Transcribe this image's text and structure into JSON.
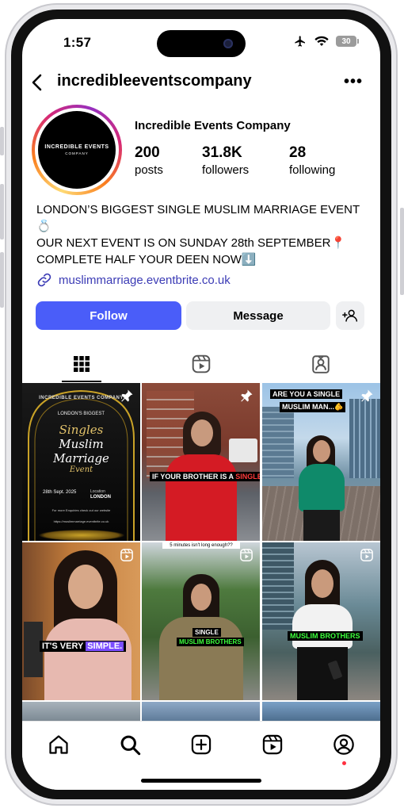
{
  "status_bar": {
    "time": "1:57",
    "battery": "30"
  },
  "header": {
    "username": "incredibleeventscompany",
    "more": "•••"
  },
  "profile": {
    "avatar_line1": "INCREDIBLE EVENTS",
    "avatar_line2": "COMPANY",
    "full_name": "Incredible Events Company",
    "stats": [
      {
        "value": "200",
        "label": "posts"
      },
      {
        "value": "31.8K",
        "label": "followers"
      },
      {
        "value": "28",
        "label": "following"
      }
    ],
    "bio": [
      "LONDON’S BIGGEST SINGLE MUSLIM MARRIAGE EVENT💍",
      "OUR NEXT EVENT IS ON SUNDAY 28th SEPTEMBER📍",
      "COMPLETE HALF YOUR DEEN NOW⬇️"
    ],
    "link": "muslimmarriage.eventbrite.co.uk"
  },
  "actions": {
    "follow": "Follow",
    "message": "Message"
  },
  "posts": {
    "p1": {
      "brand": "INCREDIBLE EVENTS COMPANY",
      "kicker": "LONDON'S BIGGEST",
      "title1": "Singles",
      "title2": "Muslim",
      "title3": "Marriage",
      "title4": "Event",
      "date": "28th Sept. 2025",
      "location_label": "Location",
      "location": "LONDON",
      "note": "For more Enquiries check out our website",
      "url": "https://muslimmarriage.eventbrite.co.uk"
    },
    "p2": {
      "caption_a": "IF YOUR BROTHER IS A ",
      "caption_b": "SINGLE MUSLIM..."
    },
    "p3": {
      "caption_l1": "ARE YOU A SINGLE",
      "caption_l2": "MUSLIM MAN...🫵"
    },
    "p4": {
      "caption_a": "IT'S VERY ",
      "caption_b": "SIMPLE."
    },
    "p5": {
      "top": "5 minutes isn't long enough??",
      "caption_l1": "SINGLE",
      "caption_l2": "MUSLIM BROTHERS"
    },
    "p6": {
      "caption": "MUSLIM BROTHERS"
    }
  },
  "colors": {
    "follow": "#4a5df9",
    "link": "#3b3bb5",
    "caption_green": "#3cff3c",
    "caption_purple": "#7b4dff",
    "caption_red": "#ff3b3b",
    "notification": "#ff3040"
  }
}
